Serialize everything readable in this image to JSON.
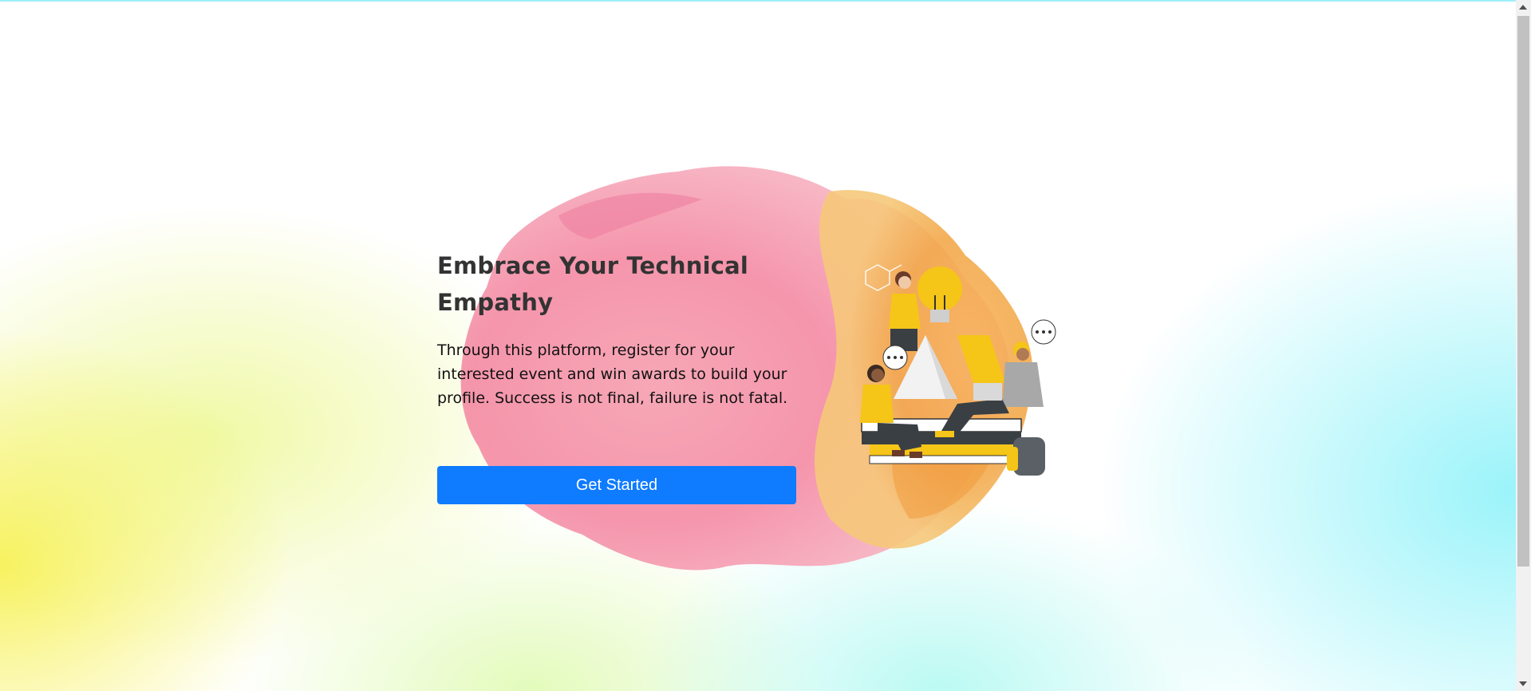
{
  "hero": {
    "title": "Embrace Your Technical Empathy",
    "description": "Through this platform, register for your interested event and win awards to build your profile. Success is not final, failure is not fatal.",
    "cta_label": "Get Started"
  },
  "illustration": {
    "name": "team-collaboration-illustration",
    "speech_bubble_text": "..."
  },
  "colors": {
    "accent": "#0f7bff",
    "title": "#333333",
    "splash_pink": "#f48ca5",
    "splash_orange": "#f2a84a",
    "wash_yellow": "#f3ef5a",
    "wash_cyan": "#8ef2f6"
  }
}
